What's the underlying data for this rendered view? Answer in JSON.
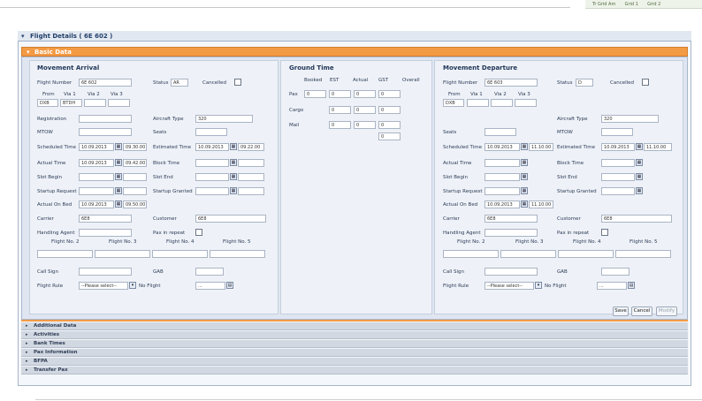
{
  "top_badge": [
    "Tr Grid Am",
    "Grid 1",
    "Grid 2"
  ],
  "window_title": "Flight Details ( 6E 602 )",
  "basic_data_label": "Basic Data",
  "arrival": {
    "title": "Movement Arrival",
    "labels": {
      "flight_number": "Flight Number",
      "status": "Status",
      "cancelled": "Cancelled",
      "from": "From",
      "via1": "Via 1",
      "via2": "Via 2",
      "via3": "Via 3",
      "registration": "Registration",
      "aircraft_type": "Aircraft Type",
      "mtow": "MTOW",
      "seats": "Seats",
      "scheduled": "Scheduled Time",
      "estimated": "Estimated Time",
      "actual": "Actual Time",
      "block": "Block Time",
      "slot_begin": "Slot Begin",
      "slot_end": "Slot End",
      "startup_request": "Startup Request",
      "startup_granted": "Startup Granted",
      "actual_on_bed": "Actual On Bed",
      "carrier": "Carrier",
      "customer": "Customer",
      "handling_agent": "Handling Agent",
      "pax_repeat": "Pax in repeat",
      "flight_nos": [
        "Flight No. 2",
        "Flight No. 3",
        "Flight No. 4",
        "Flight No. 5"
      ],
      "call_sign": "Call Sign",
      "gate": "GAB",
      "flight_rule": "Flight Rule",
      "no_flight": "No Flight"
    },
    "values": {
      "flight_number": "6E 602",
      "status": "AR",
      "from": "DXB",
      "via1": "BTDH",
      "aircraft_type": "320",
      "sched_date": "10.09.2013",
      "sched_time": "09.30.00",
      "est_date": "10.09.2013",
      "est_time": "09.22.00",
      "actual_date": "10.09.2013",
      "actual_time": "09.42.00",
      "on_bed_date": "10.09.2013",
      "on_bed_time": "09.50.00",
      "carrier": "6E8",
      "customer": "6E8",
      "select_placeholder": "--Please select--",
      "no_flight_value": "..."
    }
  },
  "ground_time": {
    "title": "Ground Time",
    "headers": [
      "Booked",
      "EST",
      "Actual",
      "GST",
      "Overall"
    ],
    "rows": [
      {
        "label": "Pax",
        "values": [
          "0",
          "0",
          "0",
          "0"
        ]
      },
      {
        "label": "Cargo",
        "values": [
          "0",
          "0",
          "0"
        ]
      },
      {
        "label": "Mail",
        "values": [
          "0",
          "0",
          "0"
        ]
      },
      {
        "label": "",
        "values": [
          "0"
        ]
      }
    ]
  },
  "departure": {
    "title": "Movement Departure",
    "values": {
      "flight_number": "6E 603",
      "status": "D",
      "from": "DXB",
      "aircraft_type": "320",
      "sched_date": "10.09.2013",
      "sched_time": "11.10.00",
      "est_date": "10.09.2013",
      "est_time": "11.10.00",
      "on_bed_date": "10.09.2013",
      "on_bed_time": "11.10.00",
      "carrier": "6E8",
      "customer": "6E8",
      "select_placeholder": "--Please select--",
      "no_flight_value": "..."
    }
  },
  "buttons": {
    "save": "Save",
    "cancel": "Cancel",
    "modify": "Modify"
  },
  "sections": [
    "Additional Data",
    "Activities",
    "Bank Times",
    "Pax Information",
    "BFPA",
    "Transfer Pax"
  ]
}
